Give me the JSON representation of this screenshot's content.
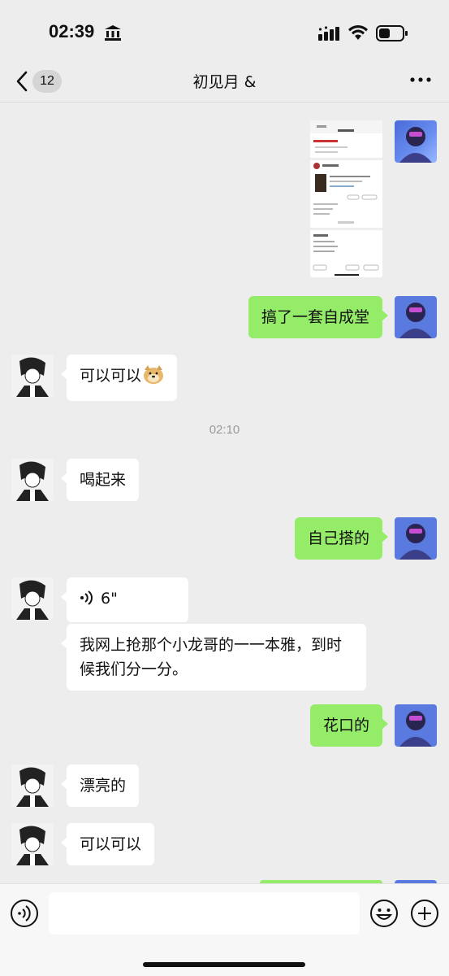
{
  "status_bar": {
    "time": "02:39"
  },
  "header": {
    "back_count": "12",
    "title": "初见月 &"
  },
  "messages": {
    "me_1": "搞了一套自成堂",
    "them_1": "可以可以",
    "timestamp": "02:10",
    "them_2": "喝起来",
    "me_2": "自己搭的",
    "voice_duration": "6\"",
    "them_3": "我网上抢那个小龙哥的一一本雅，到时候我们分一分。",
    "me_3": "花口的",
    "them_4": "漂亮的",
    "them_5": "可以可以"
  },
  "colors": {
    "my_bubble": "#95ec69",
    "their_bubble": "#ffffff",
    "background": "#ededed"
  },
  "icons": {
    "back": "chevron-left-icon",
    "more": "more-dots-icon",
    "voice": "voice-icon",
    "emoji": "emoji-icon",
    "plus": "plus-icon"
  }
}
